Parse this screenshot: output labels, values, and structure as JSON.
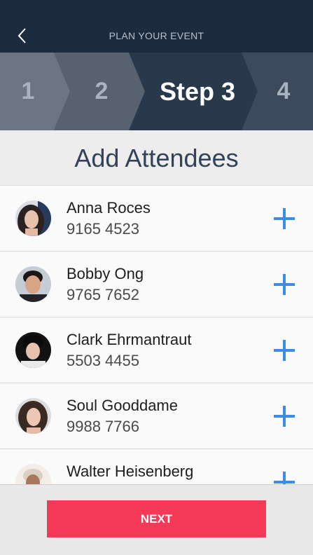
{
  "header": {
    "title": "PLAN YOUR EVENT"
  },
  "steps": [
    {
      "label": "1",
      "state": "done"
    },
    {
      "label": "2",
      "state": "done"
    },
    {
      "label": "Step 3",
      "state": "active"
    },
    {
      "label": "4",
      "state": "upcoming"
    }
  ],
  "section": {
    "title": "Add Attendees"
  },
  "attendees": [
    {
      "name": "Anna Roces",
      "phone": "9165 4523"
    },
    {
      "name": "Bobby Ong",
      "phone": "9765 7652"
    },
    {
      "name": "Clark Ehrmantraut",
      "phone": "5503 4455"
    },
    {
      "name": "Soul Gooddame",
      "phone": "9988 7766"
    },
    {
      "name": "Walter Heisenberg",
      "phone": ""
    }
  ],
  "footer": {
    "next_label": "NEXT"
  },
  "colors": {
    "topbar": "#1d2b40",
    "accent_blue": "#3b8de8",
    "next_button": "#f43a58",
    "heading_text": "#33425a"
  },
  "icons": {
    "back": "chevron-left-icon",
    "add": "plus-icon"
  }
}
